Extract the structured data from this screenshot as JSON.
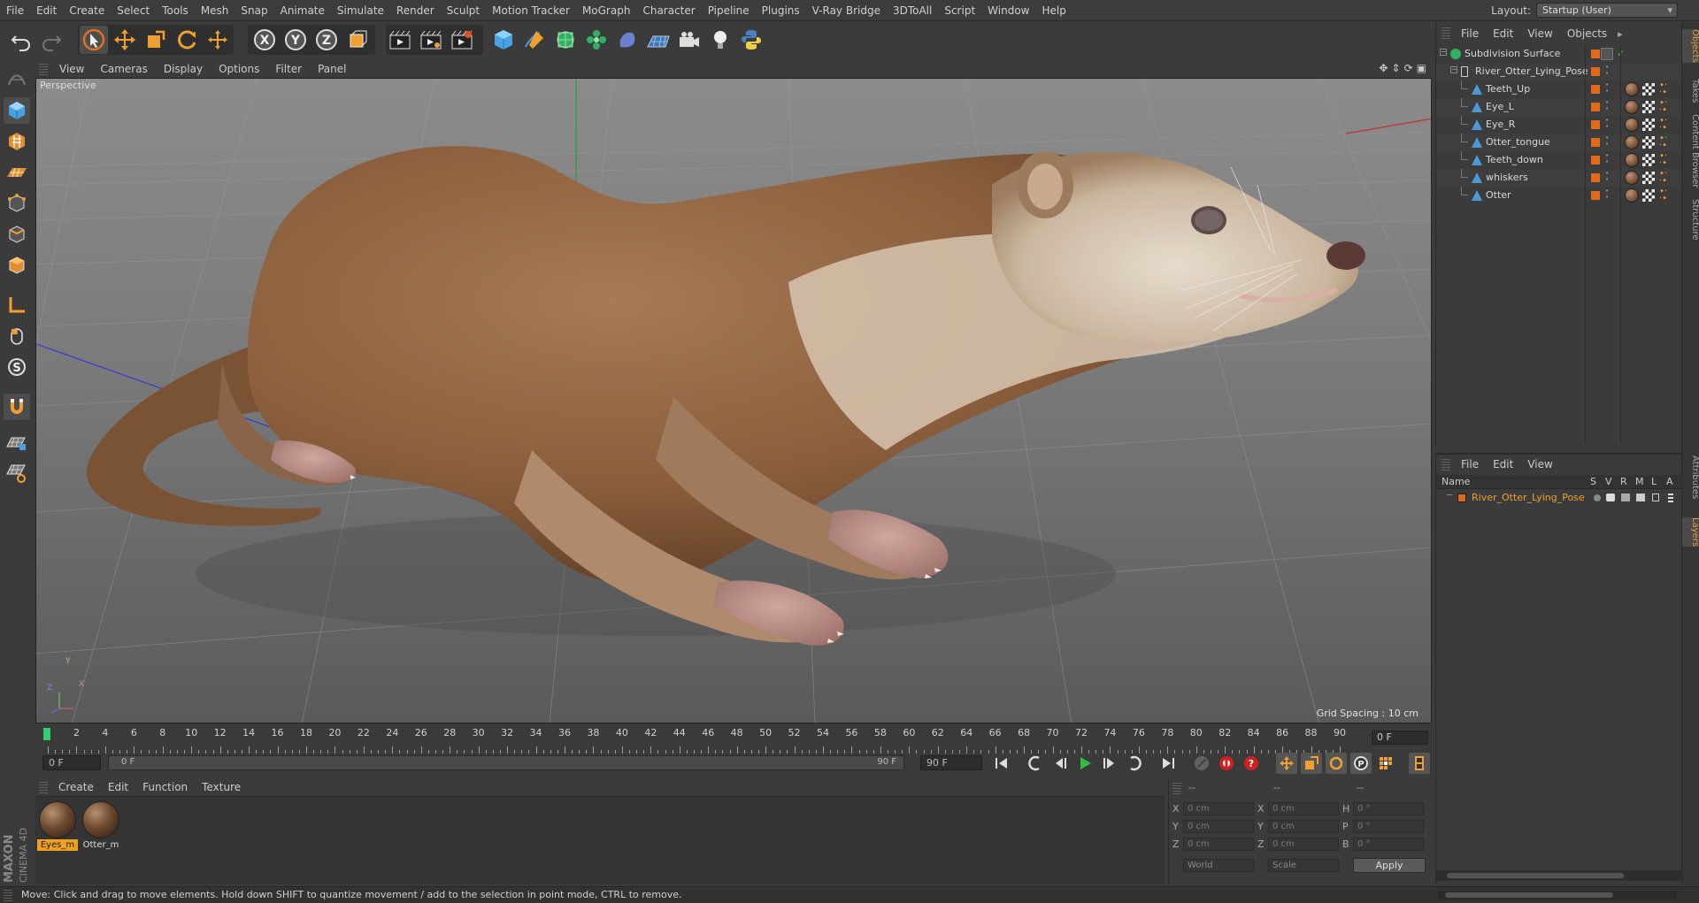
{
  "menubar": {
    "items": [
      "File",
      "Edit",
      "Create",
      "Select",
      "Tools",
      "Mesh",
      "Snap",
      "Animate",
      "Simulate",
      "Render",
      "Sculpt",
      "Motion Tracker",
      "MoGraph",
      "Character",
      "Pipeline",
      "Plugins",
      "V-Ray Bridge",
      "3DToAll",
      "Script",
      "Window",
      "Help"
    ],
    "layout_label": "Layout:",
    "layout_value": "Startup (User)"
  },
  "viewport": {
    "menu": [
      "View",
      "Cameras",
      "Display",
      "Options",
      "Filter",
      "Panel"
    ],
    "camera_label": "Perspective",
    "grid_spacing": "Grid Spacing : 10 cm",
    "axis_x": "X",
    "axis_y": "Y",
    "axis_z": "Z"
  },
  "timeline": {
    "ticks": [
      "0",
      "2",
      "4",
      "6",
      "8",
      "10",
      "12",
      "14",
      "16",
      "18",
      "20",
      "22",
      "24",
      "26",
      "28",
      "30",
      "32",
      "34",
      "36",
      "38",
      "40",
      "42",
      "44",
      "46",
      "48",
      "50",
      "52",
      "54",
      "56",
      "58",
      "60",
      "62",
      "64",
      "66",
      "68",
      "70",
      "72",
      "74",
      "76",
      "78",
      "80",
      "82",
      "84",
      "86",
      "88",
      "90"
    ],
    "current_frame_field": "0 F",
    "start_field": "0 F",
    "slider_start": "0 F",
    "slider_end": "90 F",
    "end_field": "90 F"
  },
  "materials": {
    "menu": [
      "Create",
      "Edit",
      "Function",
      "Texture"
    ],
    "items": [
      {
        "name": "Eyes_m",
        "selected": true
      },
      {
        "name": "Otter_m",
        "selected": false
      }
    ]
  },
  "coordinates": {
    "header": [
      "--",
      "--",
      "--"
    ],
    "rows": [
      {
        "a": "X",
        "av": "0 cm",
        "b": "X",
        "bv": "0 cm",
        "c": "H",
        "cv": "0 °"
      },
      {
        "a": "Y",
        "av": "0 cm",
        "b": "Y",
        "bv": "0 cm",
        "c": "P",
        "cv": "0 °"
      },
      {
        "a": "Z",
        "av": "0 cm",
        "b": "Z",
        "bv": "0 cm",
        "c": "B",
        "cv": "0 °"
      }
    ],
    "space": "World",
    "mode": "Scale",
    "apply": "Apply"
  },
  "object_manager": {
    "menu": [
      "File",
      "Edit",
      "View",
      "Objects"
    ],
    "objects": [
      {
        "name": "Subdivision Surface",
        "indent": 0
      },
      {
        "name": "River_Otter_Lying_Pose",
        "indent": 1
      },
      {
        "name": "Teeth_Up",
        "indent": 2
      },
      {
        "name": "Eye_L",
        "indent": 2
      },
      {
        "name": "Eye_R",
        "indent": 2
      },
      {
        "name": "Otter_tongue",
        "indent": 2
      },
      {
        "name": "Teeth_down",
        "indent": 2
      },
      {
        "name": "whiskers",
        "indent": 2
      },
      {
        "name": "Otter",
        "indent": 2
      }
    ]
  },
  "layer_manager": {
    "menu": [
      "File",
      "Edit",
      "View"
    ],
    "columns": [
      "Name",
      "S",
      "V",
      "R",
      "M",
      "L",
      "A"
    ],
    "layers": [
      {
        "name": "River_Otter_Lying_Pose",
        "color": "#e06a1a"
      }
    ]
  },
  "right_tabs": [
    "Objects",
    "Takes",
    "Content Browser",
    "Structure",
    "Attributes",
    "Layers"
  ],
  "branding": {
    "maxon": "MAXON",
    "product": "CINEMA 4D"
  },
  "status": "Move: Click and drag to move elements. Hold down SHIFT to quantize movement / add to the selection in point mode, CTRL to remove.",
  "colors": {
    "accent": "#f0a030",
    "selection": "#e07a20",
    "ui_bg": "#3b3b3b"
  }
}
